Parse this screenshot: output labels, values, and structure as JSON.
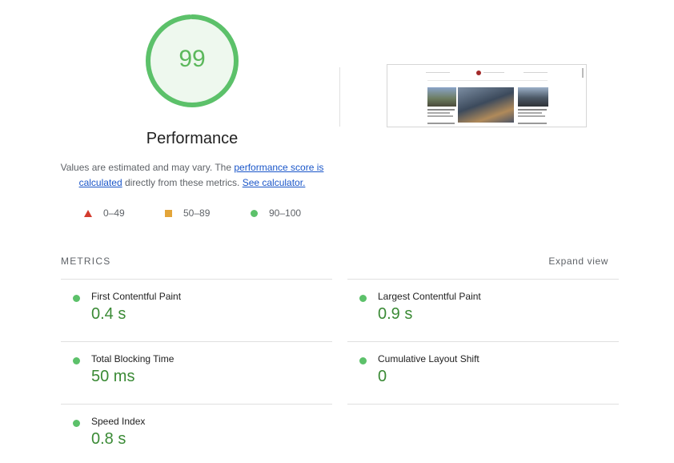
{
  "score": {
    "value": "99",
    "fraction": 0.99,
    "color": "#5cc16a",
    "title": "Performance"
  },
  "description": {
    "before_link1": "Values are estimated and may vary. The ",
    "link1": "performance score is calculated",
    "middle": " directly from these metrics. ",
    "link2": "See calculator."
  },
  "legend": [
    {
      "range": "0–49",
      "shape": "triangle",
      "color": "#d33c2e"
    },
    {
      "range": "50–89",
      "shape": "square",
      "color": "#e3a53a"
    },
    {
      "range": "90–100",
      "shape": "circle",
      "color": "#5cc16a"
    }
  ],
  "metrics_section": {
    "label": "METRICS",
    "expand_label": "Expand view"
  },
  "metrics": [
    {
      "name": "First Contentful Paint",
      "value": "0.4 s",
      "status": "pass"
    },
    {
      "name": "Largest Contentful Paint",
      "value": "0.9 s",
      "status": "pass"
    },
    {
      "name": "Total Blocking Time",
      "value": "50 ms",
      "status": "pass"
    },
    {
      "name": "Cumulative Layout Shift",
      "value": "0",
      "status": "pass"
    },
    {
      "name": "Speed Index",
      "value": "0.8 s",
      "status": "pass"
    }
  ],
  "colors": {
    "pass": "#5cc16a",
    "value_text": "#3a8a35",
    "link": "#1a56c9"
  }
}
